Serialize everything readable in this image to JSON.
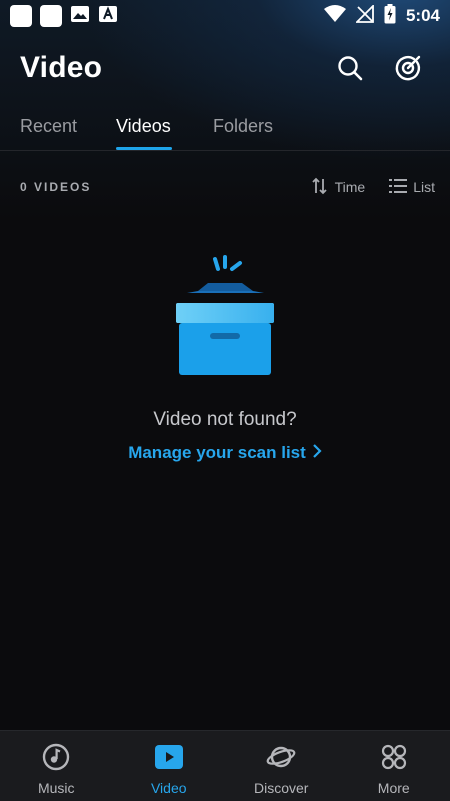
{
  "status_bar": {
    "time": "5:04",
    "left_icons": [
      "app-notification-icon",
      "app-notification-icon",
      "image-icon",
      "a-font-icon"
    ],
    "right_icons": [
      "wifi-icon",
      "no-signal-icon",
      "battery-icon"
    ]
  },
  "header": {
    "title": "Video",
    "actions": [
      "search-icon",
      "scan-target-icon"
    ]
  },
  "tabs": [
    {
      "label": "Recent",
      "active": false
    },
    {
      "label": "Videos",
      "active": true
    },
    {
      "label": "Folders",
      "active": false
    }
  ],
  "toolbar": {
    "count_label": "0 VIDEOS",
    "sort_label": "Time",
    "view_label": "List"
  },
  "empty_state": {
    "title": "Video not found?",
    "link_label": "Manage your scan list",
    "illustration": "empty-box-icon"
  },
  "bottom_nav": [
    {
      "label": "Music",
      "icon": "music-disc-icon",
      "active": false
    },
    {
      "label": "Video",
      "icon": "play-icon",
      "active": true
    },
    {
      "label": "Discover",
      "icon": "planet-icon",
      "active": false
    },
    {
      "label": "More",
      "icon": "grid-icon",
      "active": false
    }
  ],
  "colors": {
    "accent": "#27a6ec",
    "background": "#0b0b0d",
    "nav_background": "#1a1b1e"
  }
}
